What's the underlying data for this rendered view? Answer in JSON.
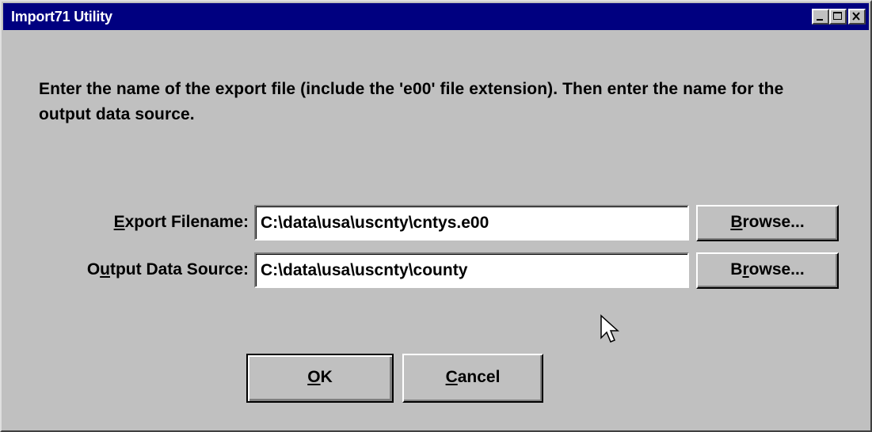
{
  "window": {
    "title": "Import71 Utility"
  },
  "title_controls": {
    "minimize_icon": "minimize-icon",
    "maximize_icon": "maximize-icon",
    "close_icon": "close-icon"
  },
  "instructions": "Enter the name of the export file (include the 'e00' file extension). Then enter the name for the output data source.",
  "fields": {
    "export_filename": {
      "label_prefix": "",
      "label_accel": "E",
      "label_rest": "xport Filename:",
      "value": "C:\\data\\usa\\uscnty\\cntys.e00",
      "browse_prefix": "",
      "browse_accel": "B",
      "browse_rest": "rowse..."
    },
    "output_data_source": {
      "label_prefix": "O",
      "label_accel": "u",
      "label_rest": "tput Data Source:",
      "value": "C:\\data\\usa\\uscnty\\county",
      "browse_prefix": "B",
      "browse_accel": "r",
      "browse_rest": "owse..."
    }
  },
  "buttons": {
    "ok_accel": "O",
    "ok_rest": "K",
    "cancel_accel": "C",
    "cancel_rest": "ancel"
  },
  "colors": {
    "titlebar": "#000080",
    "face": "#c0c0c0"
  }
}
